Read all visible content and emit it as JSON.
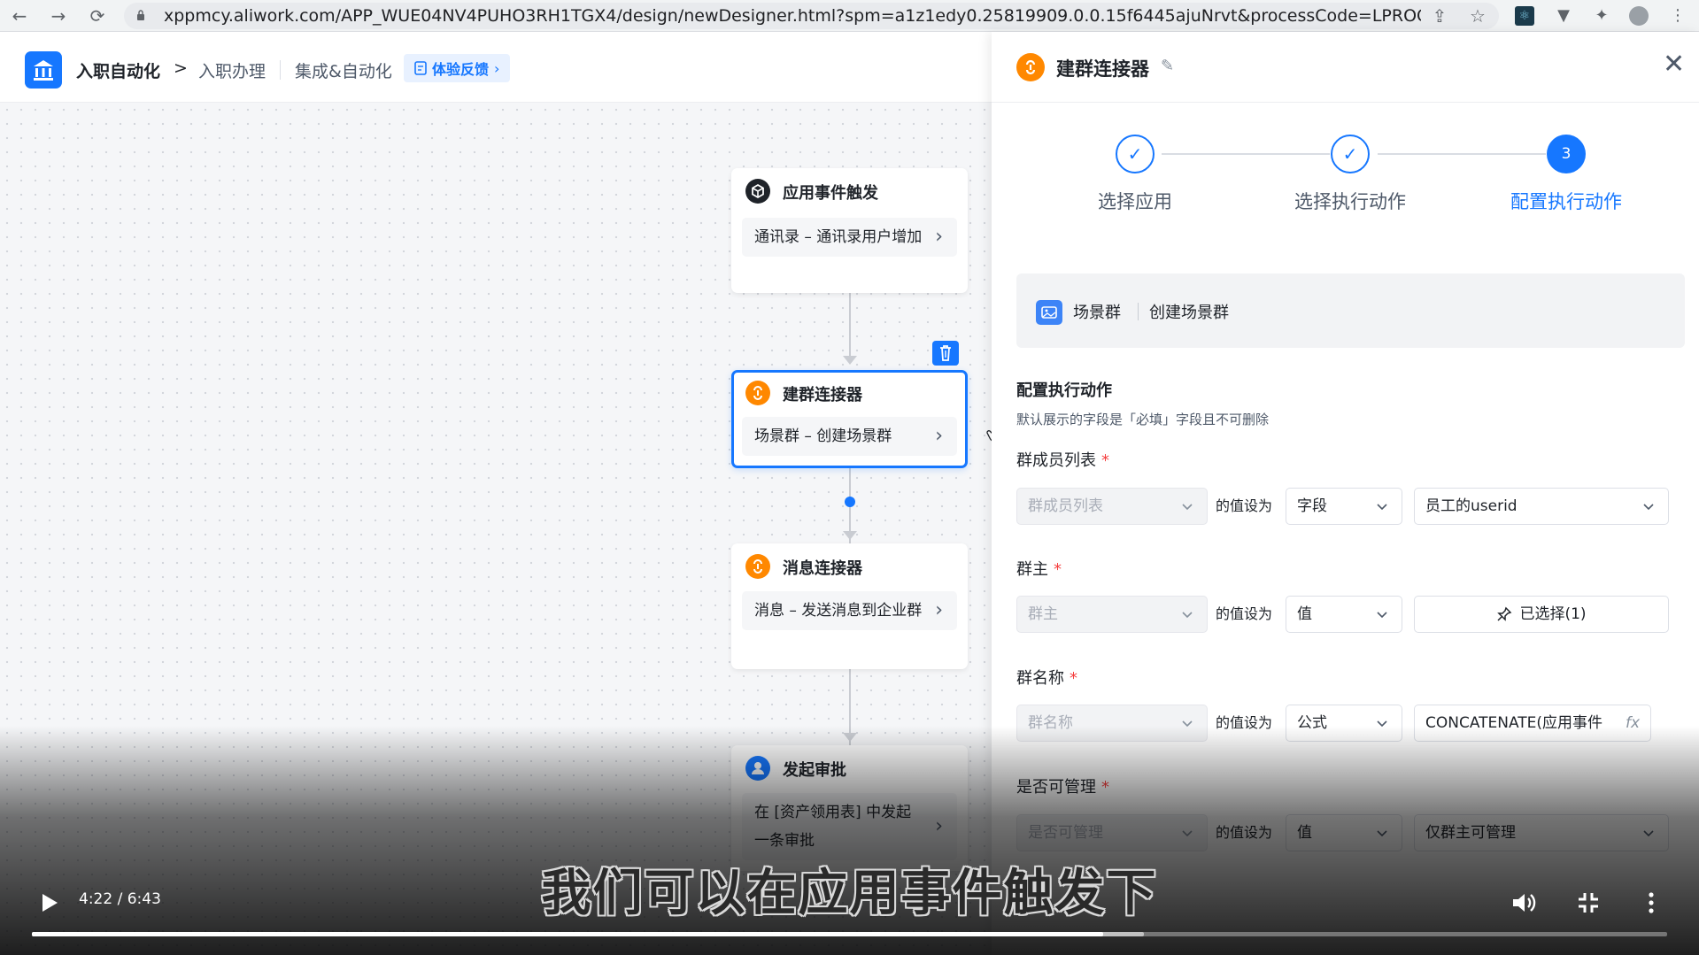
{
  "browser": {
    "url": "xppmcy.aliwork.com/APP_WUE04NV4PUHO3RH1TGX4/design/newDesigner.html?spm=a1z1edy0.25819909.0.0.15f6445ajuNrvt&processCode=LPROC-QK7..."
  },
  "header": {
    "app_name": "入职自动化",
    "crumb": "入职办理",
    "integration": "集成&自动化",
    "feedback": "体验反馈"
  },
  "flow": {
    "nodes": [
      {
        "title": "应用事件触发",
        "body": "通讯录 – 通讯录用户增加",
        "icon": "cube-icon",
        "color": "#1f2329"
      },
      {
        "title": "建群连接器",
        "body": "场景群 – 创建场景群",
        "icon": "connector-icon",
        "color": "#ff8800"
      },
      {
        "title": "消息连接器",
        "body": "消息 – 发送消息到企业群",
        "icon": "connector-icon",
        "color": "#ff8800"
      },
      {
        "title": "发起审批",
        "body": "在 [资产领用表] 中发起一条审批",
        "icon": "user-icon",
        "color": "#1677ff"
      }
    ]
  },
  "panel": {
    "title": "建群连接器",
    "steps": [
      {
        "label": "选择应用",
        "state": "done"
      },
      {
        "label": "选择执行动作",
        "state": "done"
      },
      {
        "label": "配置执行动作",
        "state": "current",
        "number": "3"
      }
    ],
    "app_bar": {
      "app": "场景群",
      "action": "创建场景群"
    },
    "section_title": "配置执行动作",
    "section_sub": "默认展示的字段是「必填」字段且不可删除",
    "set_to": "的值设为",
    "fields": [
      {
        "label": "群成员列表",
        "placeholder": "群成员列表",
        "mode": "字段",
        "value": "员工的userid",
        "value_kind": "select"
      },
      {
        "label": "群主",
        "placeholder": "群主",
        "mode": "值",
        "value": "已选择(1)",
        "value_kind": "button"
      },
      {
        "label": "群名称",
        "placeholder": "群名称",
        "mode": "公式",
        "value": "CONCATENATE(应用事件",
        "value_kind": "formula",
        "fx": "fx"
      },
      {
        "label": "是否可管理",
        "placeholder": "是否可管理",
        "mode": "值",
        "value": "仅群主可管理",
        "value_kind": "select"
      }
    ]
  },
  "video": {
    "subtitle": "我们可以在应用事件触发下",
    "time": "4:22 / 6:43",
    "progress": 0.655,
    "buffered": 0.68
  },
  "colors": {
    "accent": "#1677ff",
    "orange": "#ff8800",
    "required": "#f53f3f"
  }
}
